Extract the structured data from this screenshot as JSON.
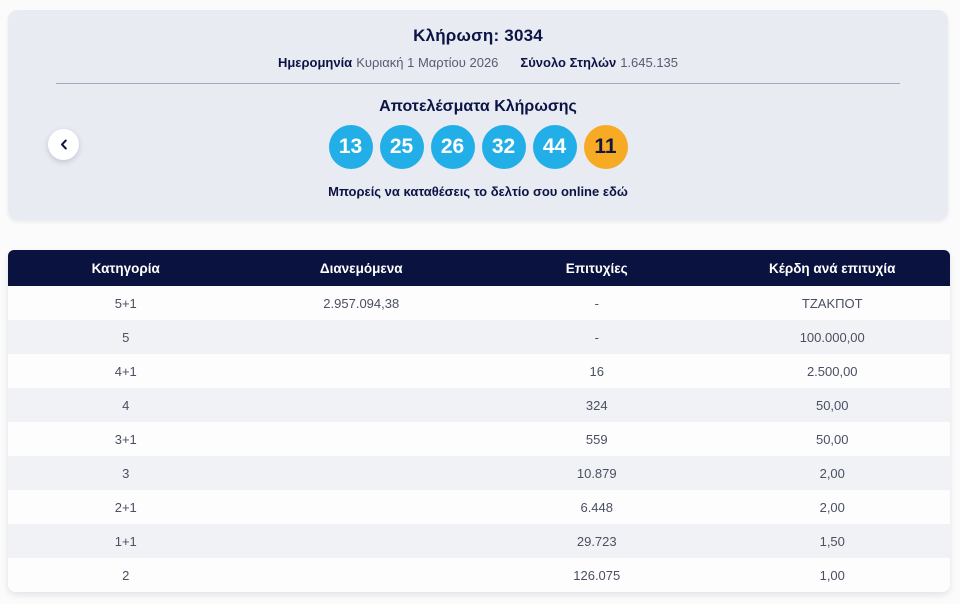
{
  "draw_card": {
    "title": "Κλήρωση: 3034",
    "date_label": "Ημερομηνία",
    "date_value": "Κυριακή 1 Μαρτίου 2026",
    "columns_label": "Σύνολο Στηλών",
    "columns_value": "1.645.135",
    "results_title": "Αποτελέσματα Κλήρωσης",
    "deposit_link_text": "Μπορείς να καταθέσεις το δελτίο σου online εδώ",
    "winning_numbers": [
      {
        "value": "13",
        "type": "main"
      },
      {
        "value": "25",
        "type": "main"
      },
      {
        "value": "26",
        "type": "main"
      },
      {
        "value": "32",
        "type": "main"
      },
      {
        "value": "44",
        "type": "main"
      },
      {
        "value": "11",
        "type": "bonus"
      }
    ],
    "colors": {
      "card_bg": "#e9ebf3",
      "main_ball": "#22afe8",
      "bonus_ball": "#f7ab25",
      "navy": "#0a1340"
    }
  },
  "prize_table": {
    "headers": [
      "Κατηγορία",
      "Διανεμόμενα",
      "Επιτυχίες",
      "Κέρδη ανά επιτυχία"
    ],
    "rows": [
      {
        "category": "5+1",
        "distributed": "2.957.094,38",
        "winners": "-",
        "prize": "ΤΖΑΚΠΟΤ"
      },
      {
        "category": "5",
        "distributed": "",
        "winners": "-",
        "prize": "100.000,00"
      },
      {
        "category": "4+1",
        "distributed": "",
        "winners": "16",
        "prize": "2.500,00"
      },
      {
        "category": "4",
        "distributed": "",
        "winners": "324",
        "prize": "50,00"
      },
      {
        "category": "3+1",
        "distributed": "",
        "winners": "559",
        "prize": "50,00"
      },
      {
        "category": "3",
        "distributed": "",
        "winners": "10.879",
        "prize": "2,00"
      },
      {
        "category": "2+1",
        "distributed": "",
        "winners": "6.448",
        "prize": "2,00"
      },
      {
        "category": "1+1",
        "distributed": "",
        "winners": "29.723",
        "prize": "1,50"
      },
      {
        "category": "2",
        "distributed": "",
        "winners": "126.075",
        "prize": "1,00"
      }
    ]
  }
}
